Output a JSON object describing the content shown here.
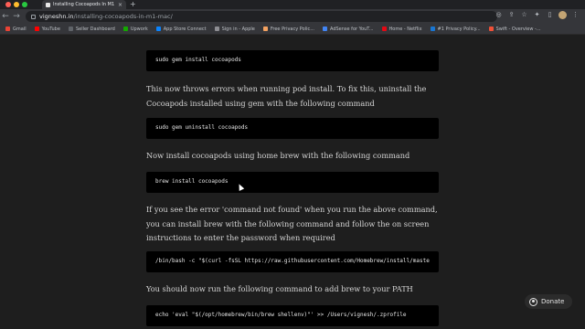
{
  "browser": {
    "tab": {
      "title": "Installing Cocoapods In M1 Ma..."
    },
    "url": {
      "host": "vigneshn.in",
      "path": "/installing-cocoapods-in-m1-mac/"
    },
    "bookmarks": [
      {
        "label": "Gmail",
        "color": "#ea4335"
      },
      {
        "label": "YouTube",
        "color": "#ff0000"
      },
      {
        "label": "Seller Dashboard",
        "color": "#5f6368"
      },
      {
        "label": "Upwork",
        "color": "#14a800"
      },
      {
        "label": "App Store Connect",
        "color": "#0a84ff"
      },
      {
        "label": "Sign in - Apple",
        "color": "#8e8e93"
      },
      {
        "label": "Free Privacy Polic...",
        "color": "#f4a261"
      },
      {
        "label": "AdSense for YouT...",
        "color": "#4285f4"
      },
      {
        "label": "Home - Netflix",
        "color": "#e50914"
      },
      {
        "label": "#1 Privacy Policy...",
        "color": "#1976d2"
      },
      {
        "label": "Swift - Overview -...",
        "color": "#f05138"
      }
    ]
  },
  "article": {
    "code1": "sudo gem install cocoapods",
    "para1": "This now throws errors when running pod install. To fix this, uninstall the Cocoapods installed using gem with the following command",
    "code2": "sudo gem uninstall cocoapods",
    "para2": "Now install cocoapods using home brew with the following command",
    "code3": "brew install cocoapods",
    "para3": "If you see the error 'command not found' when you run the above command, you can install brew with the following command and follow the on screen instructions to enter the password when required",
    "code4": "/bin/bash -c \"$(curl -fsSL https://raw.githubusercontent.com/Homebrew/install/maste",
    "para4": "You should now run the following command to add brew to your PATH",
    "code5": "echo 'eval \"$(/opt/homebrew/bin/brew shellenv)\"' >> /Users/vignesh/.zprofile"
  },
  "donate": {
    "label": "Donate"
  }
}
